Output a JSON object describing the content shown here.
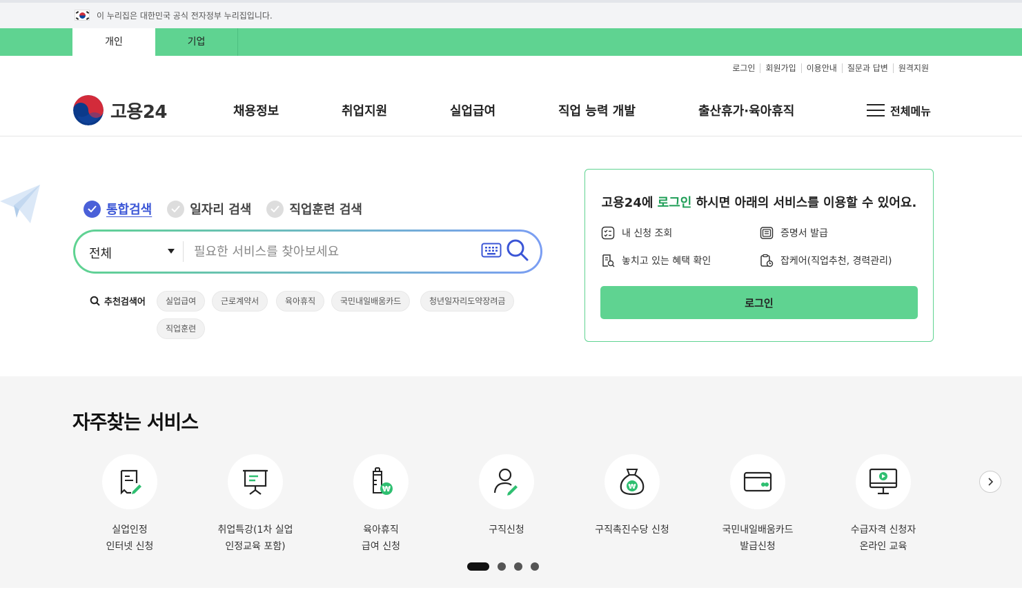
{
  "gov_banner": {
    "text": "이 누리집은 대한민국 공식 전자정부 누리집입니다."
  },
  "user_tabs": [
    {
      "label": "개인",
      "active": true
    },
    {
      "label": "기업",
      "active": false
    }
  ],
  "util_links": [
    "로그인",
    "회원가입",
    "이용안내",
    "질문과 답변",
    "원격지원"
  ],
  "logo": {
    "text": "고용24"
  },
  "gnb": [
    "채용정보",
    "취업지원",
    "실업급여",
    "직업 능력 개발",
    "출산휴가·육아휴직"
  ],
  "all_menu_label": "전체메뉴",
  "search": {
    "tabs": [
      {
        "label": "통합검색",
        "active": true
      },
      {
        "label": "일자리 검색",
        "active": false
      },
      {
        "label": "직업훈련 검색",
        "active": false
      }
    ],
    "scope_value": "전체",
    "placeholder": "필요한 서비스를 찾아보세요",
    "recommend_label": "추천검색어",
    "keywords": [
      "실업급여",
      "근로계약서",
      "육아휴직",
      "국민내일배움카드",
      "청년일자리도약장려금",
      "직업훈련"
    ]
  },
  "login_panel": {
    "msg_prefix": "고용24에 ",
    "msg_highlight": "로그인",
    "msg_suffix": " 하시면 아래의 서비스를 이용할 수 있어요.",
    "items": [
      "내 신청 조회",
      "증명서 발급",
      "놓치고 있는 혜택 확인",
      "잡케어(직업추천, 경력관리)"
    ],
    "button": "로그인"
  },
  "frequent": {
    "title": "자주찾는 서비스",
    "services": [
      {
        "line1": "실업인정",
        "line2": "인터넷 신청",
        "icon": "document-edit-icon"
      },
      {
        "line1": "취업특강(1차 실업",
        "line2": "인정교육 포함)",
        "icon": "lecture-board-icon"
      },
      {
        "line1": "육아휴직",
        "line2": "급여 신청",
        "icon": "baby-bottle-won-icon"
      },
      {
        "line1": "구직신청",
        "line2": "",
        "icon": "person-edit-icon"
      },
      {
        "line1": "구직촉진수당 신청",
        "line2": "",
        "icon": "money-bag-icon"
      },
      {
        "line1": "국민내일배움카드",
        "line2": "발급신청",
        "icon": "card-icon"
      },
      {
        "line1": "수급자격 신청자",
        "line2": "온라인 교육",
        "icon": "monitor-play-icon"
      }
    ],
    "pager_count": 4,
    "pager_active": 1
  },
  "colors": {
    "brand_green": "#5fd391",
    "accent_blue": "#3a55d6",
    "highlight_green": "#1f9e57"
  }
}
